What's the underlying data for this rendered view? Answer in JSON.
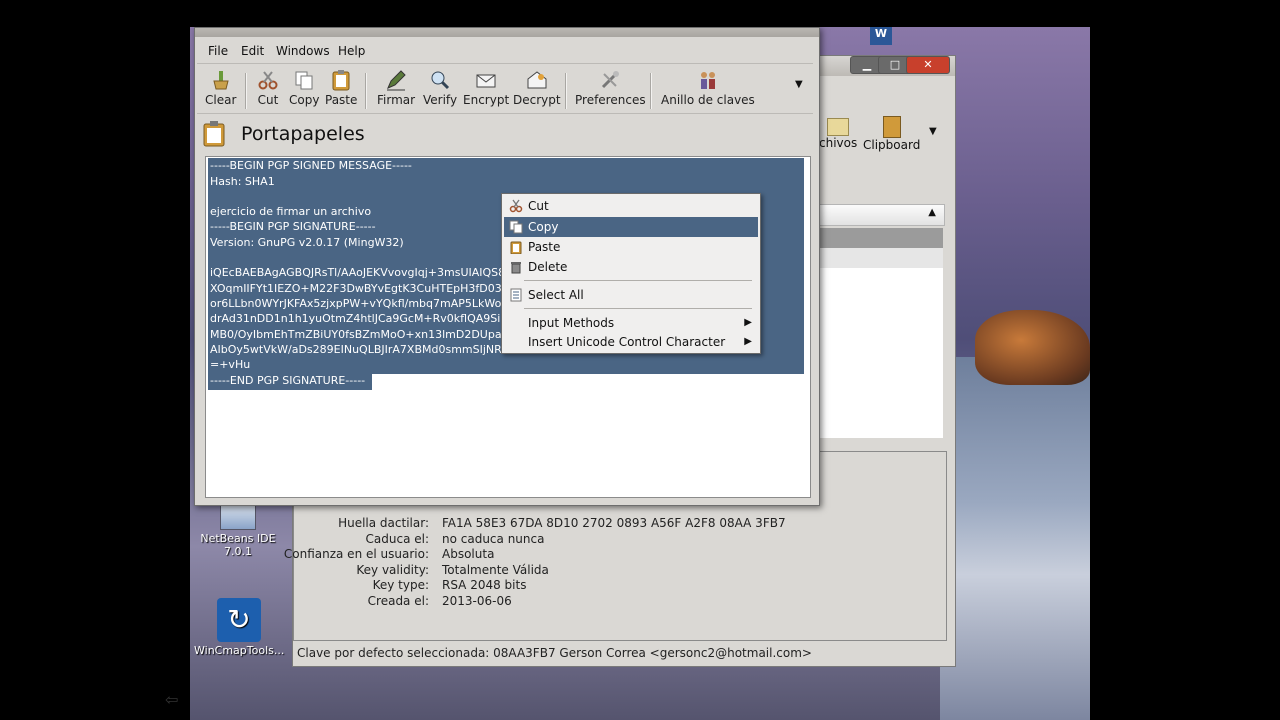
{
  "colors": {
    "selection": "#4a6584",
    "window_bg": "#dad8d4",
    "close_red": "#c8402c"
  },
  "main_window": {
    "menu": [
      {
        "label": "File"
      },
      {
        "label": "Edit"
      },
      {
        "label": "Windows"
      },
      {
        "label": "Help"
      }
    ],
    "toolbar": [
      {
        "label": "Clear",
        "icon": "broom-icon"
      },
      {
        "label": "Cut",
        "icon": "scissors-icon"
      },
      {
        "label": "Copy",
        "icon": "copy-icon"
      },
      {
        "label": "Paste",
        "icon": "clipboard-icon"
      },
      {
        "label": "Firmar",
        "icon": "sign-pen-icon"
      },
      {
        "label": "Verify",
        "icon": "verify-icon"
      },
      {
        "label": "Encrypt",
        "icon": "envelope-lock-icon"
      },
      {
        "label": "Decrypt",
        "icon": "envelope-open-icon"
      },
      {
        "label": "Preferences",
        "icon": "tools-icon"
      },
      {
        "label": "Anillo de claves",
        "icon": "people-icon"
      }
    ],
    "clipboard_title": "Portapapeles",
    "text_lines": [
      "-----BEGIN PGP SIGNED MESSAGE-----",
      "Hash: SHA1",
      "",
      "ejercicio de firmar un archivo",
      "-----BEGIN PGP SIGNATURE-----",
      "Version: GnuPG v2.0.17 (MingW32)",
      "",
      "iQEcBAEBAgAGBQJRsTl/AAoJEKVvovgIqj+3msUIAIQS8",
      "XOqmIIFYt1IEZO+M22F3DwBYvEgtK3CuHTEpH3fD030",
      "or6LLbn0WYrJKFAx5zjxpPW+vYQkfl/mbq7mAP5LkWoF",
      "drAd31nDD1n1h1yuOtmZ4htlJCa9GcM+Rv0kflQA9SiE",
      "MB0/OyIbmEhTmZBiUY0fsBZmMoO+xn13lmD2DUpahc",
      "AIbOy5wtVkW/aDs289EINuQLBJIrA7XBMd0smmSIjNR",
      "=+vHu",
      "-----END PGP SIGNATURE-----"
    ]
  },
  "context_menu": {
    "items": [
      {
        "label": "Cut",
        "icon": "scissors-icon"
      },
      {
        "label": "Copy",
        "icon": "copy-icon",
        "highlighted": true
      },
      {
        "label": "Paste",
        "icon": "clipboard-icon"
      },
      {
        "label": "Delete",
        "icon": "trash-icon"
      },
      {
        "label": "Select All",
        "icon": "select-all-icon"
      },
      {
        "label": "Input Methods",
        "submenu": true
      },
      {
        "label": "Insert Unicode Control Character",
        "submenu": true
      }
    ]
  },
  "bg_window": {
    "toolbar": [
      {
        "label": "chivos",
        "icon": "folder-icon"
      },
      {
        "label": "Clipboard",
        "icon": "clipboard-icon"
      }
    ],
    "details": [
      {
        "key": "Huella dactilar:",
        "value": "FA1A 58E3 67DA 8D10 2702  0893 A56F A2F8 08AA 3FB7"
      },
      {
        "key": "Caduca el:",
        "value": "no caduca nunca"
      },
      {
        "key": "Confianza en el usuario:",
        "value": "Absoluta"
      },
      {
        "key": "Key validity:",
        "value": "Totalmente Válida"
      },
      {
        "key": "Key type:",
        "value": "RSA 2048 bits"
      },
      {
        "key": "Creada el:",
        "value": "2013-06-06"
      }
    ],
    "status": "Clave por defecto seleccionada: 08AA3FB7 Gerson Correa <gersonc2@hotmail.com>"
  },
  "desktop_icons": [
    {
      "label": "NetBeans IDE 7.0.1",
      "icon": "netbeans-icon"
    },
    {
      "label": "WinCmapTools...",
      "icon": "wincmap-icon"
    }
  ]
}
